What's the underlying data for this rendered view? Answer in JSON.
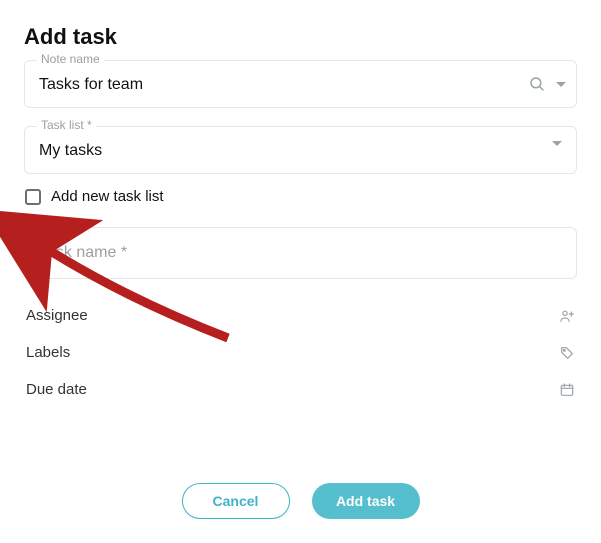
{
  "title": "Add task",
  "fields": {
    "note_name": {
      "label": "Note name",
      "value": "Tasks for team"
    },
    "task_list": {
      "label": "Task list *",
      "value": "My tasks"
    },
    "add_new_list_label": "Add new task list",
    "task_name": {
      "placeholder": "Task name",
      "required_mark": "*"
    }
  },
  "meta": {
    "assignee": {
      "label": "Assignee"
    },
    "labels": {
      "label": "Labels"
    },
    "due_date": {
      "label": "Due date"
    }
  },
  "footer": {
    "cancel": "Cancel",
    "add_task": "Add task"
  },
  "annotation": {
    "description": "red arrow pointing toward Add-new-task-list checkbox"
  }
}
